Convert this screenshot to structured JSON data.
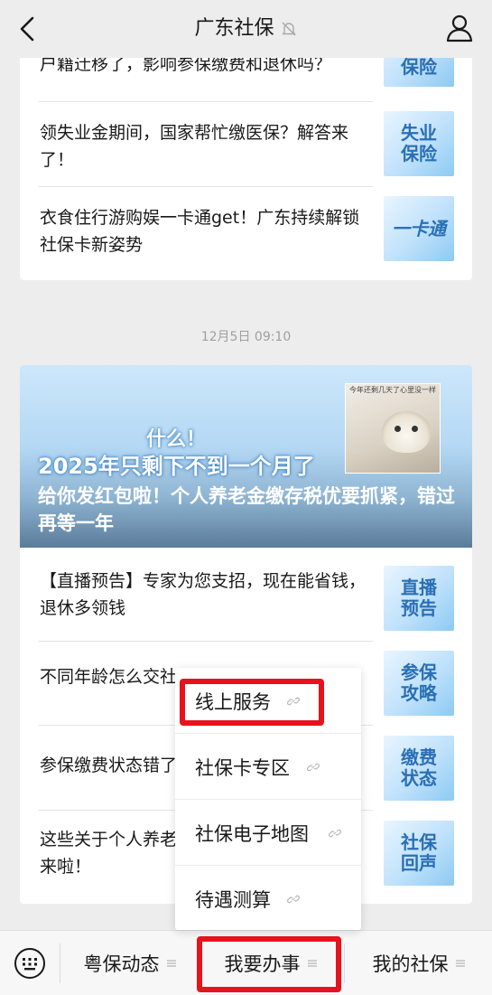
{
  "header": {
    "title": "广东社保",
    "back_icon": "chevron-left-icon",
    "mute_icon": "bell-muted-icon",
    "profile_icon": "user-icon"
  },
  "message1": {
    "articles": [
      {
        "title": "户籍迁移了，影响参保缴费和退休吗？",
        "thumb": "保险"
      },
      {
        "title": "领失业金期间，国家帮忙缴医保？解答来了！",
        "thumb": "失业\n保险"
      },
      {
        "title": "衣食住行游购娱一卡通get！广东持续解锁社保卡新姿势",
        "thumb": "一卡通"
      }
    ]
  },
  "timestamp": "12月5日 09:10",
  "message2": {
    "hero": {
      "line1": "什么！",
      "line2": "2025年只剩下不到一个月了",
      "caption": "给你发红包啦！个人养老金缴存税优要抓紧，错过再等一年",
      "cat_text": "今年还剩几天了心里没一样"
    },
    "articles": [
      {
        "title": "【直播预告】专家为您支招，现在能省钱，退休多领钱",
        "thumb": "直播\n预告"
      },
      {
        "title": "不同年龄怎么交社",
        "thumb": "参保\n攻略"
      },
      {
        "title": "参保缴费状态错了",
        "thumb": "缴费\n状态"
      },
      {
        "title": "这些关于个人养老\n来啦！",
        "thumb": "社保\n回声"
      }
    ]
  },
  "popup_menu": {
    "items": [
      "线上服务",
      "社保卡专区",
      "社保电子地图",
      "待遇测算"
    ],
    "link_icon": "link-icon"
  },
  "bottom_menu": {
    "keyboard_icon": "keyboard-icon",
    "items": [
      "粤保动态",
      "我要办事",
      "我的社保"
    ],
    "menu_icon": "menu-lines-icon"
  },
  "colors": {
    "highlight": "#e8121c",
    "background": "#ededed",
    "card": "#ffffff",
    "thumb_text": "#2a6fb5"
  }
}
